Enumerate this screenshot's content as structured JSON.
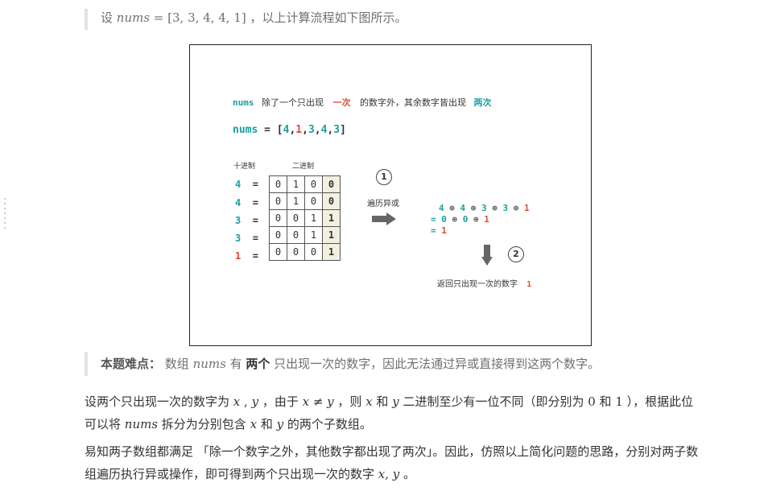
{
  "top_quote": {
    "prefix": "设 ",
    "var": "nums",
    "eq": " = [3, 3, 4, 4, 1]",
    "suffix": " ，以上计算流程如下图所示。"
  },
  "figure": {
    "line1": {
      "nums": "nums",
      "t1": "除了一个只出现",
      "once": "一次",
      "t2": "的数字外，其余数字皆出现",
      "twice": "两次"
    },
    "line2": {
      "nums": "nums",
      "eq": " = [",
      "v1": "4",
      "c1": ",",
      "v2": "1",
      "c2": ",",
      "v3": "3",
      "c3": ",",
      "v4": "4",
      "c4": ",",
      "v5": "3",
      "end": "]"
    },
    "header_dec": "十进制",
    "header_bin": "二进制",
    "rows": [
      {
        "dec": "4",
        "eq": "=",
        "bits": [
          "0",
          "1",
          "0",
          "0"
        ],
        "color": "teal",
        "last_color": "orange"
      },
      {
        "dec": "4",
        "eq": "=",
        "bits": [
          "0",
          "1",
          "0",
          "0"
        ],
        "color": "teal",
        "last_color": "orange"
      },
      {
        "dec": "3",
        "eq": "=",
        "bits": [
          "0",
          "0",
          "1",
          "1"
        ],
        "color": "teal",
        "last_color": "purple"
      },
      {
        "dec": "3",
        "eq": "=",
        "bits": [
          "0",
          "0",
          "1",
          "1"
        ],
        "color": "teal",
        "last_color": "purple"
      },
      {
        "dec": "1",
        "eq": "=",
        "bits": [
          "0",
          "0",
          "0",
          "1"
        ],
        "color": "red",
        "last_color": "purple"
      }
    ],
    "step1_num": "1",
    "step1_label": "遍历异或",
    "xor_line1": [
      "4",
      "⊕",
      "4",
      "⊕",
      "3",
      "⊕",
      "3",
      "⊕",
      "1"
    ],
    "xor_line2": {
      "eq": "= ",
      "a": "0",
      "op1": " ⊕ ",
      "b": "0",
      "op2": " ⊕ ",
      "c": "1"
    },
    "xor_line3": {
      "eq": "= ",
      "a": "1"
    },
    "step2_num": "2",
    "result_label": "返回只出现一次的数字",
    "result_value": "1",
    "colors": {
      "teal": "#1a9f9f",
      "red": "#e14b35",
      "purple": "#7b4fd6",
      "orange": "#f0a500"
    }
  },
  "difficulty_quote": {
    "bold": "本题难点：",
    "t1": " 数组 ",
    "var": "nums",
    "t2": " 有 ",
    "bold2": "两个",
    "t3": " 只出现一次的数字，因此无法通过异或直接得到这两个数字。"
  },
  "para1": {
    "t1": "设两个只出现一次的数字为 ",
    "x": "x",
    "c1": " , ",
    "y": "y",
    "t2": " ，由于 ",
    "neq": "x ≠ y",
    "t3": " ，则 ",
    "x2": "x",
    "t4": " 和 ",
    "y2": "y",
    "t5": " 二进制至少有一位不同（即分别为 ",
    "zero": "0",
    "t6": " 和 ",
    "one": "1",
    "t7": " ），根据此位可以将 ",
    "nums": "nums",
    "t8": " 拆分为分别包含 ",
    "x3": "x",
    "t9": " 和 ",
    "y3": "y",
    "t10": " 的两个子数组。"
  },
  "para2": {
    "t1": "易知两子数组都满足 「除一个数字之外，其他数字都出现了两次」。因此，仿照以上简化问题的思路，分别对两子数组遍历执行异或操作，即可得到两个只出现一次的数字 ",
    "xy": "x, y",
    "t2": " 。"
  }
}
